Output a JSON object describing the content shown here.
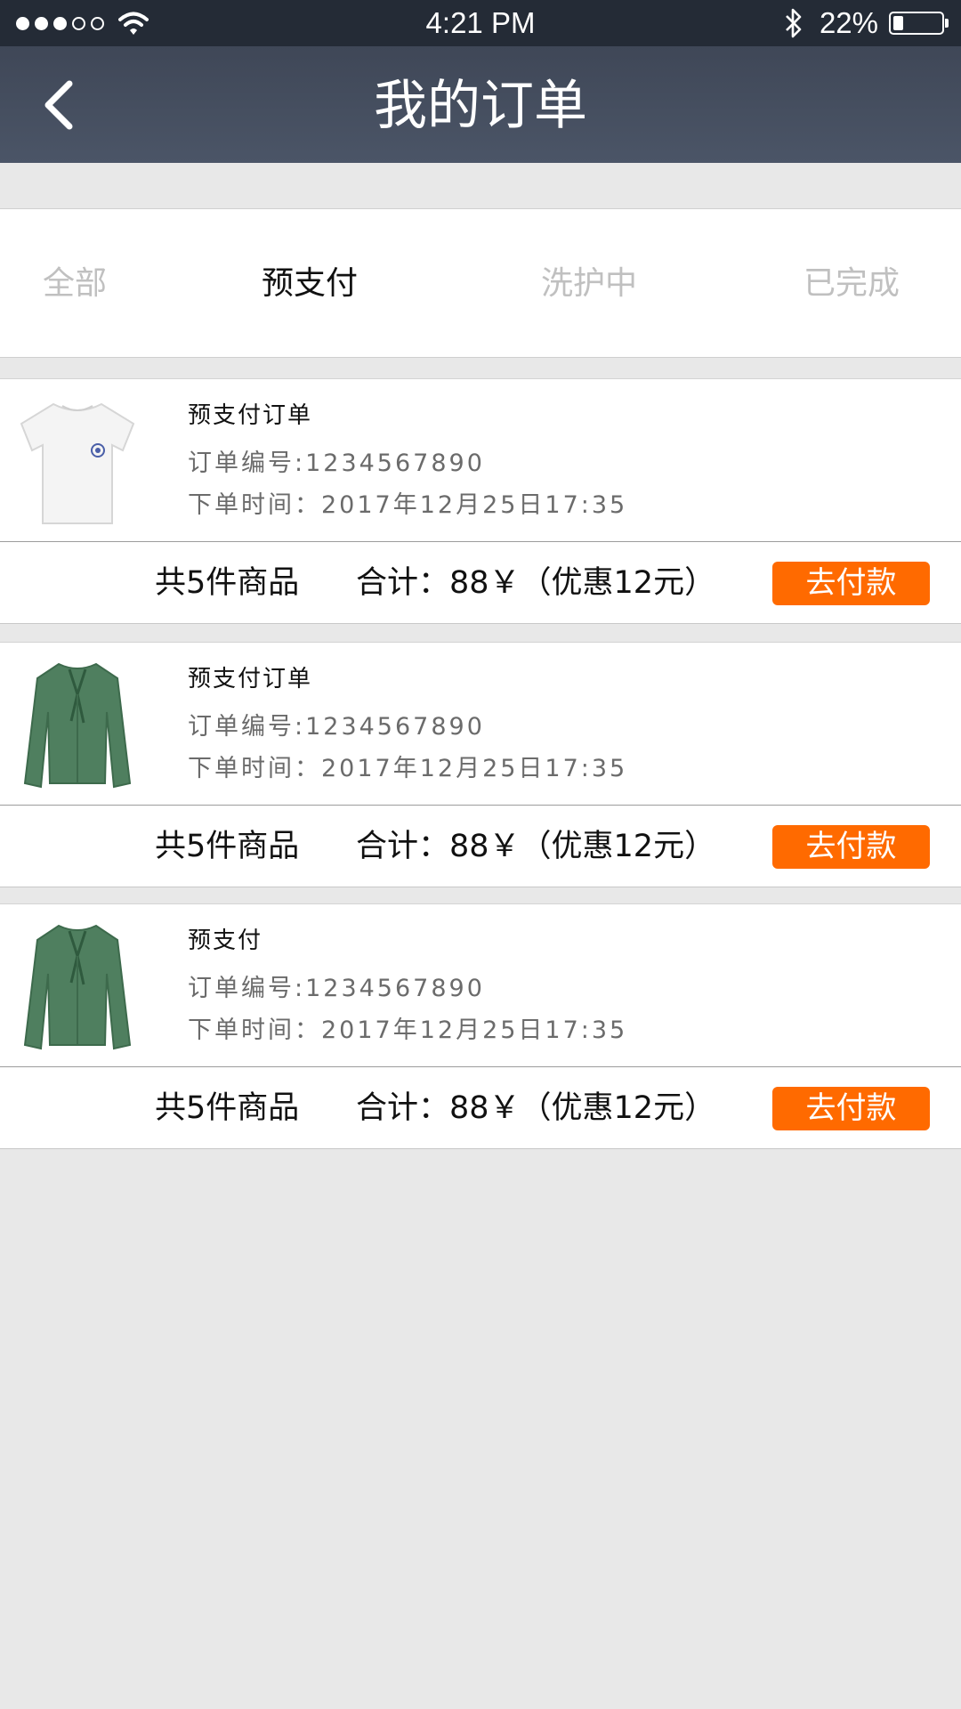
{
  "status_bar": {
    "signal_dots": [
      true,
      true,
      true,
      false,
      false
    ],
    "wifi_icon": "wifi-icon",
    "time": "4:21 PM",
    "bluetooth_icon": "bluetooth-icon",
    "battery_percent_text": "22%",
    "battery_level": 0.22
  },
  "header": {
    "back_icon": "chevron-left-icon",
    "title": "我的订单"
  },
  "tabs": [
    {
      "label": "全部",
      "active": false
    },
    {
      "label": "预支付",
      "active": true
    },
    {
      "label": "洗护中",
      "active": false
    },
    {
      "label": "已完成",
      "active": false
    }
  ],
  "orders": [
    {
      "thumbnail": "white-tshirt-image",
      "title": "预支付订单",
      "order_no": "订单编号:1234567890",
      "order_time": "下单时间：2017年12月25日17:35",
      "item_count": "共5件商品",
      "total": "合计：88￥（优惠12元）",
      "pay_label": "去付款"
    },
    {
      "thumbnail": "green-blouse-image",
      "title": "预支付订单",
      "order_no": "订单编号:1234567890",
      "order_time": "下单时间：2017年12月25日17:35",
      "item_count": "共5件商品",
      "total": "合计：88￥（优惠12元）",
      "pay_label": "去付款"
    },
    {
      "thumbnail": "green-blouse-image",
      "title": "预支付",
      "order_no": "订单编号:1234567890",
      "order_time": "下单时间：2017年12月25日17:35",
      "item_count": "共5件商品",
      "total": "合计：88￥（优惠12元）",
      "pay_label": "去付款"
    }
  ],
  "colors": {
    "status_bar": "#242b36",
    "nav_bar": "#4b5567",
    "accent_button": "#ff6a00",
    "background": "#e8e8e8",
    "tab_inactive": "#c0c0c0"
  }
}
